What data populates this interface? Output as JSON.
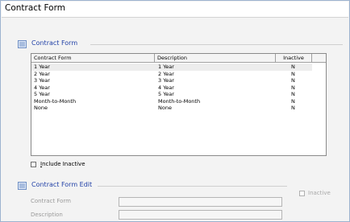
{
  "window": {
    "title": "Contract Form"
  },
  "list_section": {
    "title": "Contract Form"
  },
  "grid": {
    "columns": [
      "Contract Form",
      "Description",
      "Inactive"
    ],
    "rows": [
      {
        "form": "1 Year",
        "description": "1 Year",
        "inactive": "N"
      },
      {
        "form": "2 Year",
        "description": "2 Year",
        "inactive": "N"
      },
      {
        "form": "3 Year",
        "description": "3 Year",
        "inactive": "N"
      },
      {
        "form": "4 Year",
        "description": "4 Year",
        "inactive": "N"
      },
      {
        "form": "5 Year",
        "description": "5 Year",
        "inactive": "N"
      },
      {
        "form": "Month-to-Month",
        "description": "Month-to-Month",
        "inactive": "N"
      },
      {
        "form": "None",
        "description": "None",
        "inactive": "N"
      }
    ]
  },
  "include_inactive": {
    "label_prefix": "I",
    "label_rest": "nclude Inactive",
    "checked": false
  },
  "edit_section": {
    "title": "Contract Form Edit",
    "inactive_label_prefix": "In",
    "inactive_label_rest": "active",
    "contract_form_label": "Contract Form",
    "description_label_prefix": "Des",
    "description_label_rest": "cription",
    "contract_form_value": "",
    "description_value": ""
  },
  "colors": {
    "accent": "#1f3fa6",
    "frame": "#9db3cf"
  }
}
